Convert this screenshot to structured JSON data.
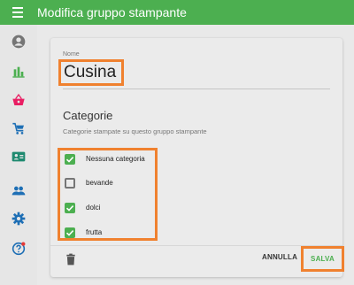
{
  "appbar": {
    "title": "Modifica gruppo stampante"
  },
  "sidebar": {
    "items": [
      {
        "icon": "account-circle-icon",
        "name": "nav-account"
      },
      {
        "icon": "bar-chart-icon",
        "name": "nav-reports"
      },
      {
        "icon": "basket-icon",
        "name": "nav-orders"
      },
      {
        "icon": "cart-icon",
        "name": "nav-cart"
      },
      {
        "icon": "badge-icon",
        "name": "nav-contacts"
      },
      {
        "icon": "people-icon",
        "name": "nav-users"
      },
      {
        "icon": "gear-icon",
        "name": "nav-settings"
      },
      {
        "icon": "help-icon",
        "name": "nav-help"
      }
    ],
    "colors": {
      "active": "#4caf50",
      "default": "#757575",
      "accent_red": "#e91e63",
      "blue": "#1e6fb5"
    }
  },
  "form": {
    "name_label": "Nome",
    "name_value": "Cusina",
    "section_title": "Categorie",
    "section_subtitle": "Categorie stampate su questo gruppo stampante",
    "categories": [
      {
        "label": "Nessuna categoria",
        "checked": true
      },
      {
        "label": "bevande",
        "checked": false
      },
      {
        "label": "dolci",
        "checked": true
      },
      {
        "label": "frutta",
        "checked": true
      }
    ]
  },
  "actions": {
    "cancel_label": "ANNULLA",
    "save_label": "SALVA",
    "delete_icon": "trash-icon"
  },
  "colors": {
    "primary": "#4caf50",
    "highlight": "#f0812f"
  }
}
